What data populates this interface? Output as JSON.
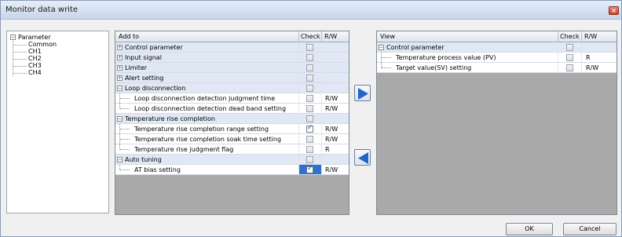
{
  "window": {
    "title": "Monitor data write",
    "close_glyph": "×"
  },
  "tree": {
    "root": "Parameter",
    "root_toggle": "−",
    "children": [
      "Common",
      "CH1",
      "CH2",
      "CH3",
      "CH4"
    ]
  },
  "add_grid": {
    "headers": {
      "name": "Add to",
      "check": "Check",
      "rw": "R/W"
    },
    "rows": [
      {
        "label": "Control parameter",
        "kind": "group",
        "toggle": "+",
        "checked": false,
        "rw": ""
      },
      {
        "label": "Input signal",
        "kind": "group",
        "toggle": "+",
        "checked": false,
        "rw": ""
      },
      {
        "label": "Limiter",
        "kind": "group",
        "toggle": "+",
        "checked": false,
        "rw": ""
      },
      {
        "label": "Alert setting",
        "kind": "group",
        "toggle": "+",
        "checked": false,
        "rw": ""
      },
      {
        "label": "Loop disconnection",
        "kind": "group",
        "toggle": "−",
        "checked": false,
        "rw": ""
      },
      {
        "label": "Loop disconnection detection judgment time",
        "kind": "child",
        "checked": false,
        "rw": "R/W"
      },
      {
        "label": "Loop disconnection detection dead band setting",
        "kind": "child-last",
        "checked": false,
        "rw": "R/W"
      },
      {
        "label": "Temperature rise completion",
        "kind": "group",
        "toggle": "−",
        "checked": false,
        "rw": ""
      },
      {
        "label": "Temperature rise completion range setting",
        "kind": "child",
        "checked": true,
        "rw": "R/W"
      },
      {
        "label": "Temperature rise completion soak time setting",
        "kind": "child",
        "checked": false,
        "rw": "R/W"
      },
      {
        "label": "Temperature rise judgment flag",
        "kind": "child-last",
        "checked": false,
        "rw": "R"
      },
      {
        "label": "Auto tuning",
        "kind": "group",
        "toggle": "−",
        "checked": false,
        "rw": ""
      },
      {
        "label": "AT bias setting",
        "kind": "child-last",
        "checked": true,
        "selected": true,
        "rw": "R/W"
      }
    ]
  },
  "view_grid": {
    "headers": {
      "name": "View",
      "check": "Check",
      "rw": "R/W"
    },
    "rows": [
      {
        "label": "Control parameter",
        "kind": "group",
        "toggle": "−",
        "checked": false,
        "rw": ""
      },
      {
        "label": "Temperature process value (PV)",
        "kind": "child",
        "checked": false,
        "rw": "R"
      },
      {
        "label": "Target value(SV) setting",
        "kind": "child-last",
        "checked": false,
        "rw": "R/W"
      }
    ]
  },
  "buttons": {
    "ok": "OK",
    "cancel": "Cancel"
  },
  "icons": {
    "add_arrow": "arrow-right-icon",
    "remove_arrow": "arrow-left-icon",
    "arrow_color": "#1f66c8"
  }
}
